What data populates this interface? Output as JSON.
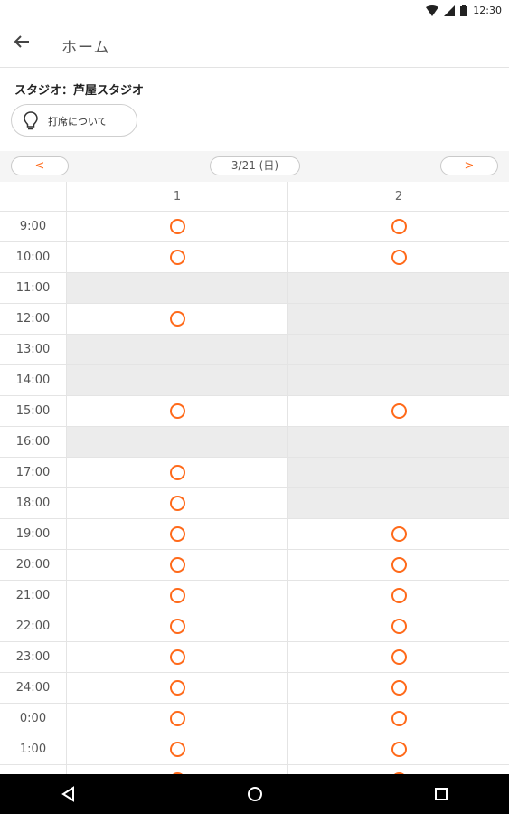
{
  "status_bar": {
    "time": "12:30",
    "icons": [
      "wifi-icon",
      "signal-icon",
      "battery-icon"
    ]
  },
  "app_bar": {
    "title": "ホーム",
    "back_icon": "arrow-left-icon"
  },
  "studio_label": "スタジオ：芦屋スタジオ",
  "about_button": {
    "label": "打席について",
    "icon": "lightbulb-icon"
  },
  "date_nav": {
    "prev": "<",
    "date": "3/21 (日)",
    "next": ">"
  },
  "columns": [
    "1",
    "2"
  ],
  "colors": {
    "accent": "#ff6a1a",
    "unavailable": "#ececec"
  },
  "schedule": [
    {
      "time": "9:00",
      "c1": "available",
      "c2": "available"
    },
    {
      "time": "10:00",
      "c1": "available",
      "c2": "available"
    },
    {
      "time": "11:00",
      "c1": "unavailable",
      "c2": "unavailable"
    },
    {
      "time": "12:00",
      "c1": "available",
      "c2": "unavailable"
    },
    {
      "time": "13:00",
      "c1": "unavailable",
      "c2": "unavailable"
    },
    {
      "time": "14:00",
      "c1": "unavailable",
      "c2": "unavailable"
    },
    {
      "time": "15:00",
      "c1": "available",
      "c2": "available"
    },
    {
      "time": "16:00",
      "c1": "unavailable",
      "c2": "unavailable"
    },
    {
      "time": "17:00",
      "c1": "available",
      "c2": "unavailable"
    },
    {
      "time": "18:00",
      "c1": "available",
      "c2": "unavailable"
    },
    {
      "time": "19:00",
      "c1": "available",
      "c2": "available"
    },
    {
      "time": "20:00",
      "c1": "available",
      "c2": "available"
    },
    {
      "time": "21:00",
      "c1": "available",
      "c2": "available"
    },
    {
      "time": "22:00",
      "c1": "available",
      "c2": "available"
    },
    {
      "time": "23:00",
      "c1": "available",
      "c2": "available"
    },
    {
      "time": "24:00",
      "c1": "available",
      "c2": "available"
    },
    {
      "time": "0:00",
      "c1": "available",
      "c2": "available"
    },
    {
      "time": "1:00",
      "c1": "available",
      "c2": "available"
    },
    {
      "time": "",
      "c1": "available",
      "c2": "available"
    }
  ],
  "system_nav": [
    "back-triangle-icon",
    "home-circle-icon",
    "recents-square-icon"
  ]
}
